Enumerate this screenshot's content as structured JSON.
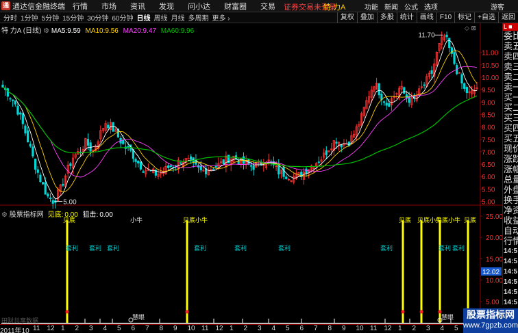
{
  "titlebar": {
    "logo": "通",
    "app_title": "通达信金融终端",
    "menus": [
      "行情",
      "市场",
      "资讯",
      "发现",
      "问小达",
      "财富圈",
      "交易"
    ],
    "login_warning": "证券交易未登录",
    "stock_title": "特 力A",
    "right_menu": [
      "功能",
      "新闻",
      "公式",
      "选项"
    ],
    "guest": "游客"
  },
  "toolbar": {
    "periods": [
      "分时",
      "1分钟",
      "5分钟",
      "15分钟",
      "30分钟",
      "60分钟",
      "日线",
      "周线",
      "月线",
      "多周期",
      "更多 ›"
    ],
    "active_period": "日线",
    "right_tools": [
      "复权",
      "叠加",
      "多股",
      "统计",
      "画线",
      "F10",
      "标记",
      "+自选",
      "返回"
    ]
  },
  "main_chart": {
    "name": "特 力A",
    "period": "(日线)",
    "ma5_label": "MA5:",
    "ma5": "9.59",
    "ma10_label": "MA10:",
    "ma10": "9.56",
    "ma20_label": "MA20:",
    "ma20": "9.47",
    "ma60_label": "MA60:",
    "ma60": "9.96",
    "high_marker": "11.70",
    "low_marker": "5.00",
    "price_ticks": [
      "11.00",
      "10.50",
      "10.00",
      "9.50",
      "9.00",
      "8.50",
      "8.00",
      "7.50",
      "7.00",
      "6.50",
      "6.00",
      "5.50",
      "5.00"
    ],
    "icons": [
      "◇",
      "⊠"
    ]
  },
  "sub_chart": {
    "name": "股票指标网",
    "jd_label": "见底:",
    "jd_value": "0.00",
    "zj_label": "狙击:",
    "zj_value": "0.00",
    "ticks": [
      "25.00",
      "20.00",
      "15.00",
      "10.00",
      "5.00"
    ],
    "current_value": "12.02",
    "labels": {
      "jiandi": "见底",
      "jiandi_xiaohao": "见底小牛",
      "xiaoniu": "小牛",
      "taoli": "套利",
      "juyan": "慧眼"
    }
  },
  "right_panel": {
    "tag": "L ■",
    "items": [
      "委比",
      "卖五",
      "卖四",
      "卖三",
      "卖二",
      "卖一",
      "买一",
      "买二",
      "买三",
      "买四",
      "买五",
      "现价",
      "涨跌",
      "涨幅",
      "总量",
      "外盘",
      "换手",
      "净资",
      "收益",
      "自动",
      "行情"
    ],
    "times": [
      "14:5",
      "14:5",
      "14:5",
      "14:5",
      "14:5",
      "14:5",
      "14:5",
      "14:5",
      "14:5"
    ]
  },
  "date_axis": {
    "first": "2011年10",
    "labels": [
      "11",
      "12",
      "1",
      "2",
      "3",
      "4",
      "5",
      "6",
      "7",
      "8",
      "9",
      "10",
      "11",
      "12",
      "1",
      "2",
      "3",
      "4",
      "5",
      "6",
      "7",
      "8",
      "9",
      "10",
      "11",
      "12",
      "1",
      "2",
      "3",
      "4",
      "5"
    ]
  },
  "watermark": {
    "line1": "股票指标网",
    "line2": "www.7gpzb.com"
  },
  "copyright": "田财共享数据",
  "colors": {
    "ma5": "#ffffff",
    "ma10": "#ffd000",
    "ma20": "#ff40ff",
    "ma60": "#00c000",
    "up": "#ff3030",
    "down": "#00d8d8",
    "signal": "#ffff00",
    "taoli": "#00c8c8",
    "axis": "#8b0000"
  },
  "chart_data": {
    "type": "candlestick",
    "ylim": [
      4.85,
      11.9
    ],
    "ma_values": {
      "MA5": 9.59,
      "MA10": 9.56,
      "MA20": 9.47,
      "MA60": 9.96
    },
    "marked_high": 11.7,
    "marked_low": 5.0,
    "price_path": [
      9.6,
      9.3,
      8.9,
      8.2,
      7.4,
      6.5,
      5.8,
      5.2,
      5.0,
      5.5,
      6.2,
      6.8,
      7.0,
      7.4,
      7.0,
      7.6,
      8.2,
      8.0,
      7.6,
      7.2,
      7.0,
      6.6,
      6.3,
      6.2,
      6.1,
      6.2,
      6.4,
      6.5,
      6.7,
      6.6,
      6.4,
      6.2,
      6.3,
      6.4,
      6.5,
      6.7,
      6.8,
      6.6,
      6.5,
      6.4,
      6.5,
      6.7,
      6.5,
      6.2,
      6.1,
      6.0,
      6.0,
      6.2,
      6.4,
      6.6,
      6.8,
      7.2,
      7.5,
      7.3,
      7.4,
      7.8,
      8.4,
      9.2,
      9.8,
      9.3,
      8.9,
      9.2,
      9.6,
      9.2,
      9.0,
      9.4,
      9.8,
      10.2,
      11.2,
      11.7,
      10.9,
      10.2,
      9.5,
      9.3,
      9.6
    ],
    "sub_indicator": {
      "ylim": [
        0,
        25
      ],
      "current": 12.02,
      "jiandi_spikes": [
        {
          "date": "2012-01",
          "value": 24
        },
        {
          "date": "2012-10",
          "value": 24
        },
        {
          "date": "2013-09",
          "value": 24
        },
        {
          "date": "2013-11",
          "value": 24
        },
        {
          "date": "2014-01",
          "value": 24
        },
        {
          "date": "2014-04",
          "value": 24
        }
      ],
      "taoli_marks": [
        "2012-01",
        "2012-03",
        "2012-04",
        "2012-11",
        "2013-02",
        "2013-05",
        "2014-01",
        "2014-03",
        "2014-04"
      ]
    }
  }
}
